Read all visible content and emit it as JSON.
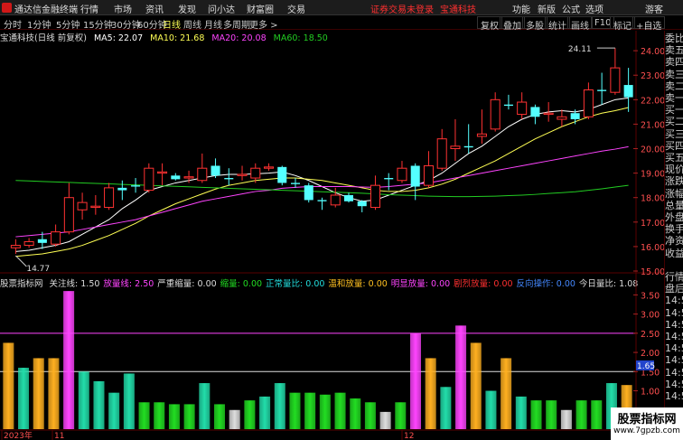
{
  "menubar": {
    "app_name": "通达信金融终端",
    "menus": [
      "行情",
      "市场",
      "资讯",
      "发现",
      "问小达",
      "财富圈",
      "交易"
    ],
    "warning": "证券交易未登录",
    "broker": "宝通科技",
    "right_items": [
      "功能",
      "新版",
      "公式",
      "选项",
      "游客"
    ]
  },
  "toolbar": {
    "periods": [
      "分时",
      "1分钟",
      "5分钟",
      "15分钟",
      "30分钟",
      "60分钟",
      "日线",
      "周线",
      "月线",
      "多周期",
      "更多 >"
    ],
    "active_period": "日线",
    "buttons": [
      "复权",
      "叠加",
      "多股",
      "统计",
      "画线",
      "F10",
      "标记",
      "+自选"
    ]
  },
  "main_legend": {
    "title": "宝通科技(日线 前复权)",
    "ma5": "MA5: 22.07",
    "ma10": "MA10: 21.68",
    "ma20": "MA20: 20.08",
    "ma60": "MA60: 18.50"
  },
  "indicator_legend": {
    "name": "股票指标网",
    "items": [
      {
        "label": "关注线: 1.50",
        "color": "#dddddd"
      },
      {
        "label": "放量线: 2.50",
        "color": "#ff44ff"
      },
      {
        "label": "严重缩量: 0.00",
        "color": "#dddddd"
      },
      {
        "label": "缩量: 0.00",
        "color": "#22dd22"
      },
      {
        "label": "正常量比: 0.00",
        "color": "#22dddd"
      },
      {
        "label": "温和放量: 0.00",
        "color": "#ffc020"
      },
      {
        "label": "明显放量: 0.00",
        "color": "#ff44ff"
      },
      {
        "label": "剧烈放量: 0.00",
        "color": "#ff3030"
      },
      {
        "label": "反向操作: 0.00",
        "color": "#4488ff"
      },
      {
        "label": "今日量比: 1.08",
        "color": "#dddddd"
      }
    ]
  },
  "price_axis": [
    "24.00",
    "23.00",
    "22.00",
    "21.00",
    "20.00",
    "19.00",
    "18.00",
    "17.00",
    "16.00",
    "15.00"
  ],
  "price_annotations": {
    "high": "24.11",
    "low": "14.77"
  },
  "indicator_axis": [
    "3.50",
    "3.00",
    "2.50",
    "2.00",
    "1.50",
    "1.00",
    "0.50"
  ],
  "indicator_marker": "1.65",
  "date_labels": [
    "2023年",
    "11",
    "12"
  ],
  "side_panel": [
    "委比",
    "卖五",
    "卖四",
    "卖三",
    "卖二",
    "卖一",
    "买一",
    "买二",
    "买三",
    "买四",
    "买五",
    "现价",
    "涨跌",
    "涨幅",
    "总量",
    "外盘",
    "换手",
    "净资",
    "收益",
    "",
    "行情",
    "盘后",
    "14:5",
    "14:5",
    "14:5",
    "14:5",
    "14:5",
    "14:5",
    "14:5",
    "14:5",
    "14:5"
  ],
  "watermark": {
    "line1": "股票指标网",
    "line2": "www.7gpzb.com"
  },
  "colors": {
    "up": "#ff3232",
    "down": "#54ffff",
    "ma5": "#ffffff",
    "ma10": "#ffff54",
    "ma20": "#ff44ff",
    "ma60": "#22cc22"
  },
  "chart_data": [
    {
      "type": "candlestick",
      "title": "宝通科技(日线 前复权)",
      "ylim": [
        15.0,
        24.3
      ],
      "candles": [
        {
          "o": 15.95,
          "c": 16.05,
          "h": 16.3,
          "l": 15.7
        },
        {
          "o": 16.05,
          "c": 16.2,
          "h": 16.35,
          "l": 15.95
        },
        {
          "o": 16.3,
          "c": 16.15,
          "h": 16.6,
          "l": 15.9
        },
        {
          "o": 16.1,
          "c": 16.6,
          "h": 16.9,
          "l": 16.0
        },
        {
          "o": 16.6,
          "c": 18.0,
          "h": 18.6,
          "l": 16.5
        },
        {
          "o": 17.5,
          "c": 17.8,
          "h": 18.2,
          "l": 17.1
        },
        {
          "o": 17.6,
          "c": 17.65,
          "h": 18.1,
          "l": 17.3
        },
        {
          "o": 17.6,
          "c": 18.4,
          "h": 18.6,
          "l": 17.5
        },
        {
          "o": 18.4,
          "c": 18.3,
          "h": 18.7,
          "l": 17.9
        },
        {
          "o": 18.5,
          "c": 18.45,
          "h": 18.8,
          "l": 18.2
        },
        {
          "o": 18.3,
          "c": 19.2,
          "h": 19.4,
          "l": 18.2
        },
        {
          "o": 19.0,
          "c": 19.05,
          "h": 19.4,
          "l": 18.5
        },
        {
          "o": 18.9,
          "c": 18.75,
          "h": 19.0,
          "l": 18.7
        },
        {
          "o": 18.8,
          "c": 18.85,
          "h": 19.1,
          "l": 18.6
        },
        {
          "o": 18.7,
          "c": 19.2,
          "h": 19.8,
          "l": 18.6
        },
        {
          "o": 19.3,
          "c": 18.9,
          "h": 19.6,
          "l": 18.8
        },
        {
          "o": 18.8,
          "c": 18.75,
          "h": 19.2,
          "l": 18.5
        },
        {
          "o": 18.9,
          "c": 18.95,
          "h": 19.3,
          "l": 18.7
        },
        {
          "o": 18.8,
          "c": 19.2,
          "h": 19.4,
          "l": 18.6
        },
        {
          "o": 19.2,
          "c": 19.25,
          "h": 19.4,
          "l": 19.1
        },
        {
          "o": 19.25,
          "c": 18.6,
          "h": 19.3,
          "l": 18.5
        },
        {
          "o": 18.6,
          "c": 18.55,
          "h": 18.8,
          "l": 18.4
        },
        {
          "o": 18.5,
          "c": 17.9,
          "h": 18.6,
          "l": 17.8
        },
        {
          "o": 17.9,
          "c": 17.85,
          "h": 18.0,
          "l": 17.5
        },
        {
          "o": 17.7,
          "c": 18.1,
          "h": 18.4,
          "l": 17.6
        },
        {
          "o": 18.1,
          "c": 17.85,
          "h": 18.2,
          "l": 17.8
        },
        {
          "o": 17.85,
          "c": 17.65,
          "h": 17.9,
          "l": 17.4
        },
        {
          "o": 17.6,
          "c": 18.5,
          "h": 18.9,
          "l": 17.5
        },
        {
          "o": 18.8,
          "c": 18.75,
          "h": 19.0,
          "l": 18.3
        },
        {
          "o": 18.7,
          "c": 19.2,
          "h": 19.5,
          "l": 18.6
        },
        {
          "o": 19.3,
          "c": 18.45,
          "h": 19.4,
          "l": 17.9
        },
        {
          "o": 18.5,
          "c": 19.3,
          "h": 19.9,
          "l": 18.4
        },
        {
          "o": 19.2,
          "c": 20.4,
          "h": 20.8,
          "l": 19.1
        },
        {
          "o": 20.0,
          "c": 20.1,
          "h": 21.2,
          "l": 19.5
        },
        {
          "o": 20.1,
          "c": 20.05,
          "h": 21.0,
          "l": 19.8
        },
        {
          "o": 20.5,
          "c": 20.6,
          "h": 21.6,
          "l": 20.2
        },
        {
          "o": 20.8,
          "c": 22.0,
          "h": 22.3,
          "l": 20.7
        },
        {
          "o": 21.8,
          "c": 21.75,
          "h": 22.2,
          "l": 21.6
        },
        {
          "o": 21.4,
          "c": 21.9,
          "h": 22.3,
          "l": 21.2
        },
        {
          "o": 21.7,
          "c": 21.3,
          "h": 21.8,
          "l": 21.0
        },
        {
          "o": 21.4,
          "c": 21.45,
          "h": 21.9,
          "l": 21.1
        },
        {
          "o": 21.2,
          "c": 21.3,
          "h": 21.6,
          "l": 20.9
        },
        {
          "o": 21.45,
          "c": 21.2,
          "h": 21.6,
          "l": 21.0
        },
        {
          "o": 21.3,
          "c": 22.4,
          "h": 22.7,
          "l": 21.2
        },
        {
          "o": 22.4,
          "c": 22.35,
          "h": 23.1,
          "l": 21.8
        },
        {
          "o": 22.3,
          "c": 23.3,
          "h": 24.11,
          "l": 22.2
        },
        {
          "o": 22.6,
          "c": 22.1,
          "h": 23.3,
          "l": 21.5
        }
      ],
      "ma_series": [
        {
          "name": "MA5",
          "values": [
            15.8,
            15.85,
            15.95,
            16.05,
            16.2,
            16.5,
            16.8,
            17.1,
            17.55,
            17.9,
            18.3,
            18.45,
            18.6,
            18.7,
            18.8,
            18.9,
            18.95,
            18.95,
            18.97,
            19.0,
            19.05,
            18.9,
            18.7,
            18.45,
            18.2,
            18.0,
            17.85,
            17.9,
            18.1,
            18.3,
            18.5,
            18.7,
            19.0,
            19.4,
            19.8,
            20.1,
            20.5,
            20.9,
            21.2,
            21.4,
            21.5,
            21.55,
            21.5,
            21.6,
            21.8,
            22.0,
            22.07
          ]
        },
        {
          "name": "MA10",
          "values": [
            15.6,
            15.65,
            15.7,
            15.8,
            15.9,
            16.05,
            16.25,
            16.45,
            16.7,
            16.95,
            17.25,
            17.5,
            17.75,
            17.95,
            18.15,
            18.35,
            18.5,
            18.6,
            18.7,
            18.75,
            18.8,
            18.8,
            18.75,
            18.7,
            18.6,
            18.5,
            18.4,
            18.3,
            18.25,
            18.25,
            18.3,
            18.4,
            18.55,
            18.75,
            19.0,
            19.25,
            19.5,
            19.8,
            20.1,
            20.4,
            20.65,
            20.9,
            21.1,
            21.3,
            21.45,
            21.55,
            21.68
          ]
        },
        {
          "name": "MA20",
          "values": [
            16.4,
            16.45,
            16.5,
            16.55,
            16.6,
            16.7,
            16.8,
            16.9,
            17.0,
            17.1,
            17.25,
            17.4,
            17.55,
            17.7,
            17.85,
            17.95,
            18.05,
            18.15,
            18.25,
            18.3,
            18.38,
            18.42,
            18.45,
            18.45,
            18.45,
            18.45,
            18.43,
            18.42,
            18.45,
            18.5,
            18.55,
            18.6,
            18.7,
            18.8,
            18.9,
            19.0,
            19.1,
            19.2,
            19.3,
            19.4,
            19.5,
            19.6,
            19.7,
            19.8,
            19.9,
            19.98,
            20.08
          ]
        },
        {
          "name": "MA60",
          "values": [
            18.7,
            18.68,
            18.66,
            18.64,
            18.62,
            18.6,
            18.58,
            18.56,
            18.54,
            18.52,
            18.5,
            18.48,
            18.46,
            18.44,
            18.42,
            18.4,
            18.38,
            18.36,
            18.34,
            18.32,
            18.3,
            18.28,
            18.26,
            18.24,
            18.22,
            18.2,
            18.18,
            18.15,
            18.12,
            18.1,
            18.08,
            18.06,
            18.05,
            18.04,
            18.04,
            18.05,
            18.06,
            18.08,
            18.1,
            18.13,
            18.17,
            18.2,
            18.24,
            18.3,
            18.36,
            18.43,
            18.5
          ]
        }
      ]
    },
    {
      "type": "bar",
      "title": "股票指标网",
      "ylim": [
        0.0,
        3.65
      ],
      "hlines": [
        {
          "value": 2.5,
          "color": "#ff44ff"
        },
        {
          "value": 1.5,
          "color": "#dddddd"
        }
      ],
      "values": [
        2.25,
        1.6,
        1.85,
        1.85,
        3.6,
        1.5,
        1.25,
        0.95,
        1.45,
        0.7,
        0.7,
        0.65,
        0.65,
        1.2,
        0.65,
        0.5,
        0.75,
        0.85,
        1.2,
        0.95,
        0.95,
        0.9,
        0.95,
        0.8,
        0.7,
        0.45,
        0.7,
        2.5,
        1.85,
        1.1,
        2.7,
        2.25,
        1.0,
        1.85,
        0.85,
        0.75,
        0.75,
        0.5,
        0.75,
        0.75,
        1.2,
        1.15
      ],
      "colors": [
        "#ffb020",
        "#22ddaa",
        "#ffb020",
        "#ffb020",
        "#ff44ff",
        "#22ddaa",
        "#22ddaa",
        "#22ddaa",
        "#22ddaa",
        "#22dd22",
        "#22dd22",
        "#22dd22",
        "#22dd22",
        "#22ddaa",
        "#22dd22",
        "#dddddd",
        "#22dd22",
        "#22ddaa",
        "#22ddaa",
        "#22dd22",
        "#22dd22",
        "#22dd22",
        "#22dd22",
        "#22dd22",
        "#22dd22",
        "#dddddd",
        "#22dd22",
        "#ff44ff",
        "#ffb020",
        "#22ddaa",
        "#ff44ff",
        "#ffb020",
        "#22ddaa",
        "#ffb020",
        "#22ddaa",
        "#22dd22",
        "#22dd22",
        "#dddddd",
        "#22dd22",
        "#22dd22",
        "#22ddaa",
        "#ffb020"
      ]
    }
  ]
}
